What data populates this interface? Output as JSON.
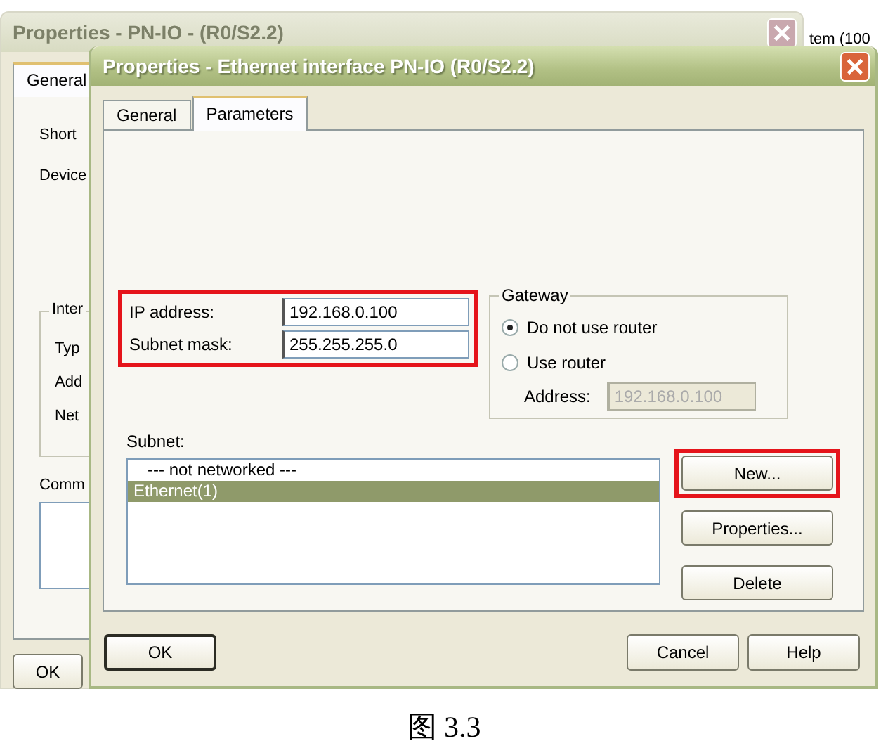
{
  "background_window": {
    "title": "Properties - PN-IO - (R0/S2.2)",
    "active": false,
    "tabs": [
      {
        "label": "General",
        "selected": true
      }
    ],
    "labels": [
      "Short",
      "Device"
    ],
    "group": {
      "title": "Inter",
      "labels": [
        "Typ",
        "Add",
        "Net"
      ]
    },
    "comment_label": "Comm",
    "buttons": [
      "OK"
    ]
  },
  "behind_text": "tem (100",
  "window": {
    "title": "Properties - Ethernet interface  PN-IO (R0/S2.2)",
    "active": true
  },
  "tabs": [
    {
      "label": "General",
      "selected": false
    },
    {
      "label": "Parameters",
      "selected": true
    }
  ],
  "address": {
    "highlighted": true,
    "fields": [
      {
        "label": "IP address:",
        "value": "192.168.0.100"
      },
      {
        "label": "Subnet mask:",
        "value": "255.255.255.0"
      }
    ]
  },
  "gateway": {
    "title": "Gateway",
    "options": [
      {
        "label": "Do not use router",
        "selected": true
      },
      {
        "label": "Use router",
        "selected": false
      }
    ],
    "address": {
      "label": "Address:",
      "value": "192.168.0.100",
      "disabled": true
    }
  },
  "subnet": {
    "label": "Subnet:",
    "items": [
      {
        "label": "--- not networked ---",
        "selected": false
      },
      {
        "label": "Ethernet(1)",
        "selected": true
      }
    ]
  },
  "side_buttons": [
    {
      "label": "New...",
      "highlighted": true
    },
    {
      "label": "Properties...",
      "highlighted": false
    },
    {
      "label": "Delete",
      "highlighted": false
    }
  ],
  "buttons": [
    {
      "label": "OK",
      "default": true
    },
    {
      "label": "Cancel",
      "default": false
    },
    {
      "label": "Help",
      "default": false
    }
  ],
  "caption": "图 3.3"
}
